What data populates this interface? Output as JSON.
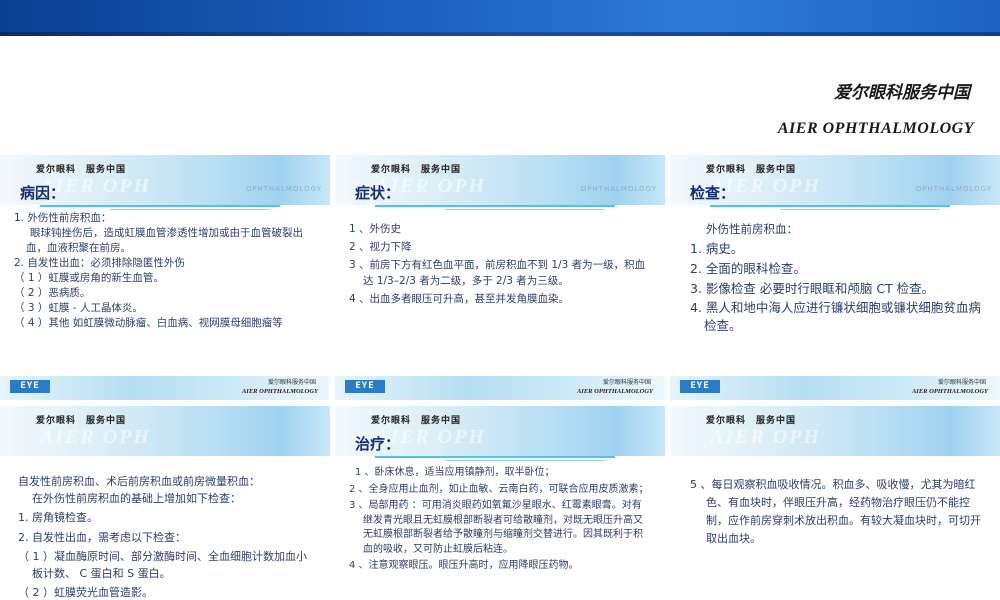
{
  "brand": {
    "cn": "爱尔眼科服务中国",
    "en": "AIER OPHTHALMOLOGY"
  },
  "slide_header": {
    "cn": "爱尔眼科　服务中国",
    "ghost": "AIER OPH",
    "ghost_right": "OPHTHALMOLOGY"
  },
  "slide_footer": {
    "logo": "EYE",
    "cn": "爱尔眼科服务中国",
    "en": "AIER OPHTHALMOLOGY"
  },
  "slides": [
    {
      "title": "病因：",
      "lines": [
        "1. 外伤性前房积血：",
        "眼球钝挫伤后，造成虹膜血管渗透性增加或由于血管破裂出血，血液积聚在前房。",
        "2. 自发性出血：必须排除隐匿性外伤",
        "（ 1 ）虹膜或房角的新生血管。",
        "（ 2 ）恶病质。",
        "（ 3 ）虹膜 - 人工晶体炎。",
        "（ 4 ）其他  如虹膜微动脉瘤、白血病、视网膜母细胞瘤等"
      ]
    },
    {
      "title": "症状：",
      "lines": [
        "1 、外伤史",
        "2 、视力下降",
        "3 、前房下方有红色血平面，前房积血不到 1/3 者为一级，积血达 1/3–2/3 者为二级，多于 2/3 者为三级。",
        "4 、出血多者眼压可升高，甚至并发角膜血染。"
      ]
    },
    {
      "title": "检查：",
      "lines": [
        "外伤性前房积血：",
        "1. 病史。",
        "2. 全面的眼科检查。",
        "3. 影像检查  必要时行眼眶和颅脑 CT 检查。",
        "4. 黑人和地中海人应进行镰状细胞或镰状细胞贫血病检查。"
      ]
    },
    {
      "title": "",
      "lines": [
        "自发性前房积血、术后前房积血或前房微量积血：",
        "在外伤性前房积血的基础上增加如下检查：",
        "1. 房角镜检查。",
        "2. 自发性出血，需考虑以下检查：",
        "（ 1 ）凝血酶原时间、部分激酶时间、全血细胞计数加血小板计数、 C 蛋白和 S 蛋白。",
        "（ 2 ）虹膜荧光血管造影。"
      ]
    },
    {
      "title": "治疗：",
      "lines": [
        "1 、卧床休息，适当应用镇静剂，取半卧位；",
        "2 、全身应用止血剂，如止血敏、云南白药，可联合应用皮质激素；",
        "3 、局部用药 ：可用消炎眼药如氧氟沙星眼水、红霉素眼膏。对有继发青光眼且无虹膜根部断裂者可给散瞳剂，对既无眼压升高又无虹膜根部断裂者给予散瞳剂与缩瞳剂交替进行。因其既利于积血的吸收，又可防止虹膜后粘连。",
        "4 、注意观察眼压。眼压升高时，应用降眼压药物。"
      ]
    },
    {
      "title": "",
      "lines": [
        "5 、每日观察积血吸收情况。积血多、吸收慢，尤其为暗红色、有血块时，伴眼压升高，经药物治疗眼压仍不能控制，应作前房穿刺术放出积血。有较大凝血块时，可切开取出血块。"
      ]
    }
  ]
}
